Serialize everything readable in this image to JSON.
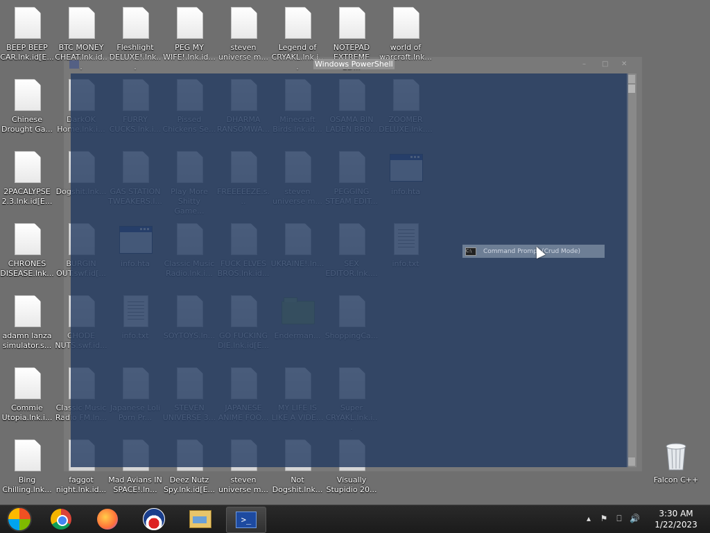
{
  "desktop": {
    "icons": [
      {
        "label": "BEEP BEEP CAR.lnk.id[E...",
        "type": "file"
      },
      {
        "label": "BTC MONEY CHEAT.lnk.id...",
        "type": "file"
      },
      {
        "label": "Fleshlight DELUXE!.lnk...",
        "type": "file"
      },
      {
        "label": "PEG MY WIFE!.lnk.id...",
        "type": "file"
      },
      {
        "label": "steven universe m...",
        "type": "file"
      },
      {
        "label": "Legend of CRYAKL.lnk.i...",
        "type": "file"
      },
      {
        "label": "NOTEPAD EXTREME ED...",
        "type": "file"
      },
      {
        "label": "world of warcraft.lnk...",
        "type": "file"
      },
      {
        "label": "Chinese Drought Ga...",
        "type": "file"
      },
      {
        "label": "DarkOK Home.lnk.i...",
        "type": "file"
      },
      {
        "label": "FURRY CUCKS.lnk.i...",
        "type": "file"
      },
      {
        "label": "Pissed Chickens Se...",
        "type": "file"
      },
      {
        "label": "DHARMA RANSOMWA...",
        "type": "file"
      },
      {
        "label": "Minecraft Birds.lnk.id...",
        "type": "file"
      },
      {
        "label": "OSAMA BIN LADEN BRO...",
        "type": "file"
      },
      {
        "label": "ZOOMER DELUXE.lnk....",
        "type": "file"
      },
      {
        "label": "2PACALYPSE 2.3.lnk.id[E...",
        "type": "file"
      },
      {
        "label": "Dogshit.lnk...",
        "type": "file"
      },
      {
        "label": "GAS STATION TWEAKERS.l...",
        "type": "file"
      },
      {
        "label": "Play More Shitty Game...",
        "type": "file"
      },
      {
        "label": "FREEEEEZE.s...",
        "type": "file"
      },
      {
        "label": "steven universe m...",
        "type": "file"
      },
      {
        "label": "PEGGING STEAM EDIT...",
        "type": "file"
      },
      {
        "label": "info.hta",
        "type": "hta"
      },
      {
        "label": "CHRONES DISEASE.lnk...",
        "type": "file"
      },
      {
        "label": "BURGIN OUT.swf.id[...",
        "type": "file"
      },
      {
        "label": "info.hta",
        "type": "hta"
      },
      {
        "label": "Classic Music Radio.lnk.i...",
        "type": "file"
      },
      {
        "label": "FUCK ELVES BROS.lnk.id...",
        "type": "file"
      },
      {
        "label": "UKRAINE!.ln...",
        "type": "file"
      },
      {
        "label": "SEX EDITOR.lnk....",
        "type": "file"
      },
      {
        "label": "info.txt",
        "type": "txt"
      },
      {
        "label": "adamn lanza simulator.s...",
        "type": "file"
      },
      {
        "label": "CHODE NUTS.swf.id...",
        "type": "file"
      },
      {
        "label": "info.txt",
        "type": "txt"
      },
      {
        "label": "SOYTOYS.ln...",
        "type": "file"
      },
      {
        "label": "GO FUCKING DIE.lnk.id[E...",
        "type": "file"
      },
      {
        "label": "Enderman...",
        "type": "folder"
      },
      {
        "label": "ShoppingCa...",
        "type": "file"
      },
      {
        "label": "Commie Utopia.lnk.i...",
        "type": "file"
      },
      {
        "label": "Classic Music Radio FM.ln...",
        "type": "file"
      },
      {
        "label": "Japanese Loli Porn Pr...",
        "type": "file"
      },
      {
        "label": "STEVEN UNIVERSE 3...",
        "type": "file"
      },
      {
        "label": "JAPANESE ANIME FOO...",
        "type": "file"
      },
      {
        "label": "MY LIFE IS LIKE A VIDE...",
        "type": "file"
      },
      {
        "label": "Super CRYAKL.lnk.i...",
        "type": "file"
      },
      {
        "label": "Bing Chilling.lnk...",
        "type": "file"
      },
      {
        "label": "faggot night.lnk.id...",
        "type": "file"
      },
      {
        "label": "Mad Avians IN SPACE!.ln...",
        "type": "file"
      },
      {
        "label": "Deez Nutz Spy.lnk.id[E...",
        "type": "file"
      },
      {
        "label": "steven universe m...",
        "type": "file"
      },
      {
        "label": "Not Dogshit.lnk...",
        "type": "file"
      },
      {
        "label": "Visually Stupidio 20...",
        "type": "file"
      }
    ],
    "recycle_bin": {
      "label": "Falcon C++"
    }
  },
  "powershell": {
    "title": "Windows PowerShell"
  },
  "cmd_mini": {
    "title": "Command Prompt (Crud Mode)",
    "icon_text": "C:\\"
  },
  "taskbar": {
    "apps": [
      {
        "name": "start-orb"
      },
      {
        "name": "chrome-icon"
      },
      {
        "name": "firefox-icon"
      },
      {
        "name": "obama-icon"
      },
      {
        "name": "explorer-icon"
      },
      {
        "name": "powershell-icon",
        "glyph": ">_",
        "active": true
      }
    ],
    "tray": {
      "chevron": "▴",
      "flag": "⚑",
      "network": "⎕",
      "volume": "🔊"
    },
    "clock": {
      "time": "3:30 AM",
      "date": "1/22/2023"
    }
  }
}
